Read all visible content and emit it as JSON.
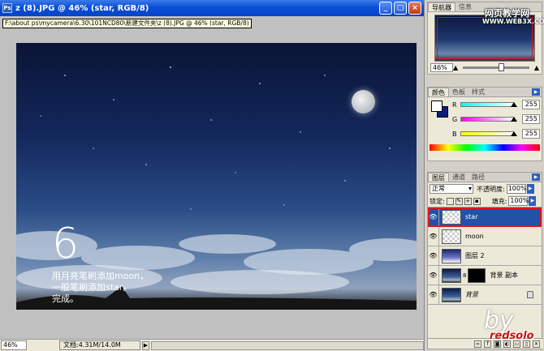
{
  "window": {
    "title": "z (8).JPG @ 46% (star, RGB/8)",
    "tooltip": "F:\\about ps\\mycamera\\6.30\\101NCD80\\新建文件夹\\z (8).JPG @ 46% (star, RGB/8)",
    "btn_minimize": "_",
    "btn_maximize": "□",
    "btn_close": "×"
  },
  "canvas": {
    "step_number": "6",
    "caption_line1": "用月亮笔刷添加moon，",
    "caption_line2": "一般笔刷添加star。",
    "caption_line3": "完成。"
  },
  "status": {
    "zoom": "46%",
    "doc_info": "文档:4.31M/14.0M",
    "arrow": "▶"
  },
  "navigator": {
    "tabs": [
      "导航器",
      "信息"
    ],
    "zoom": "46%"
  },
  "color": {
    "tabs": [
      "颜色",
      "色板",
      "样式"
    ],
    "channels": [
      {
        "label": "R",
        "value": "255",
        "level": 1.0
      },
      {
        "label": "G",
        "value": "255",
        "level": 1.0
      },
      {
        "label": "B",
        "value": "255",
        "level": 1.0
      }
    ],
    "background_color": "#0e1c7a"
  },
  "layers": {
    "tabs": [
      "图层",
      "通道",
      "路径"
    ],
    "blend_mode": "正常",
    "opacity_label": "不透明度:",
    "opacity": "100%",
    "lock_label": "锁定:",
    "fill_label": "填充:",
    "fill": "100%",
    "items": [
      {
        "name": "star",
        "thumb": "transparent",
        "selected": true
      },
      {
        "name": "moon",
        "thumb": "transparent",
        "selected": false
      },
      {
        "name": "图层 2",
        "thumb": "gradient",
        "selected": false
      },
      {
        "name": "背景 副本",
        "thumb": "sky-mask",
        "selected": false
      },
      {
        "name": "背景",
        "thumb": "sky",
        "selected": false,
        "locked": true
      }
    ]
  },
  "watermark": {
    "site_name": "网页教学网",
    "site_url": "WWW.WEB3X.COM",
    "by": "by",
    "author": "redsolo"
  },
  "colors": {
    "title_bar": "#0a4fd8",
    "selection": "#2450a8",
    "highlight_outline": "#d81818"
  }
}
